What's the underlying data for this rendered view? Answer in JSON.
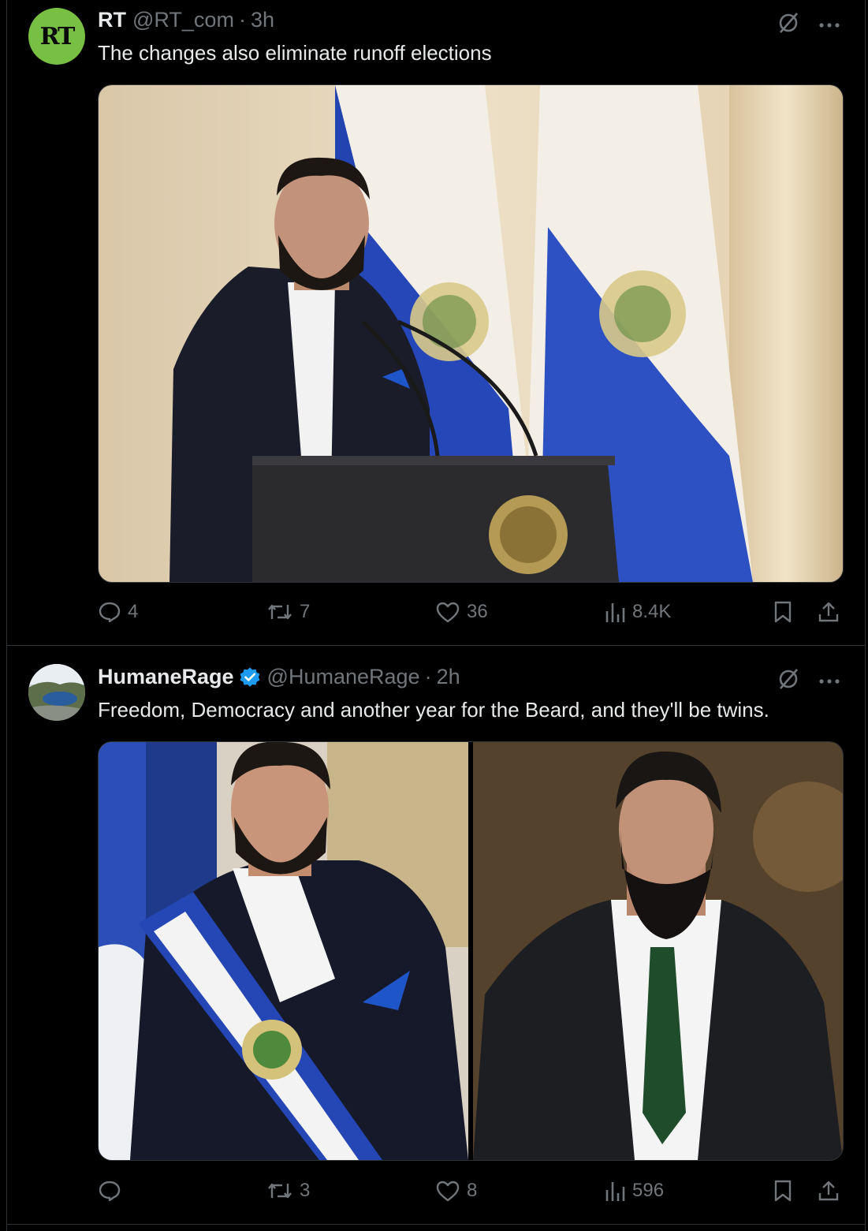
{
  "tweets": [
    {
      "avatar_text": "RT",
      "name": "RT",
      "handle": "@RT_com",
      "time": "3h",
      "text": "The changes also eliminate runoff elections",
      "stats": {
        "replies": "4",
        "reposts": "7",
        "likes": "36",
        "views": "8.4K"
      }
    },
    {
      "name": "HumaneRage",
      "handle": "@HumaneRage",
      "time": "2h",
      "text": "Freedom, Democracy and another year for the Beard, and they'll be twins.",
      "stats": {
        "replies": "",
        "reposts": "3",
        "likes": "8",
        "views": "596"
      }
    }
  ],
  "separator": "·",
  "colors": {
    "accent_blue": "#1d9bf0",
    "muted": "#71767b",
    "text": "#e7e9ea",
    "rt_green": "#77c043"
  },
  "icons": [
    "grok-icon",
    "more-icon",
    "reply-icon",
    "repost-icon",
    "like-icon",
    "views-icon",
    "bookmark-icon",
    "share-icon",
    "verified-badge-icon"
  ]
}
